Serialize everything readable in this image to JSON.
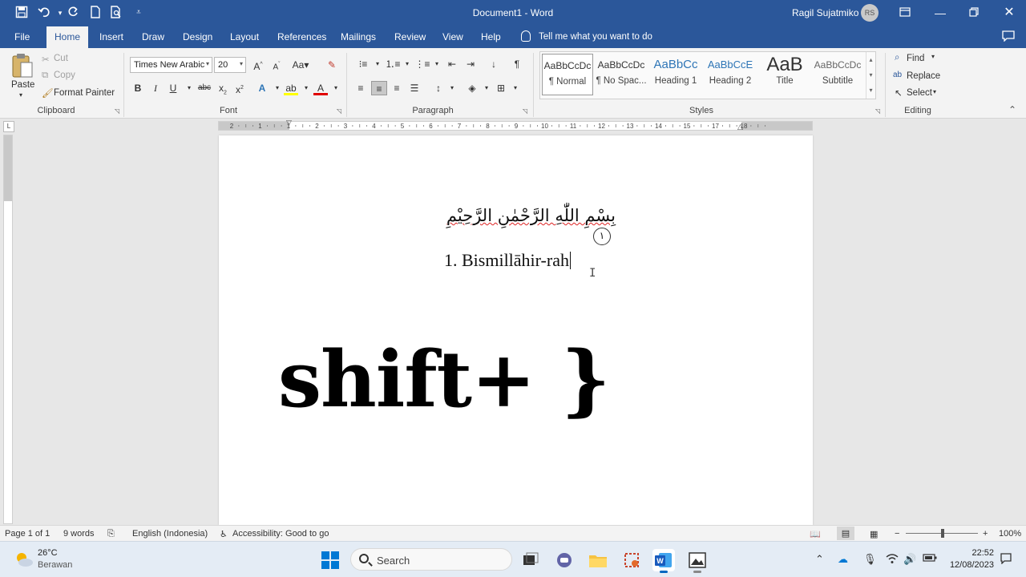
{
  "titlebar": {
    "title": "Document1  -  Word",
    "user": "Ragil Sujatmiko",
    "avatar_initials": "RS",
    "bg_color": "#2b579a"
  },
  "tabs": [
    "File",
    "Home",
    "Insert",
    "Draw",
    "Design",
    "Layout",
    "References",
    "Mailings",
    "Review",
    "View",
    "Help"
  ],
  "active_tab": "Home",
  "tell_me": "Tell me what you want to do",
  "ribbon": {
    "clipboard": {
      "paste": "Paste",
      "cut": "Cut",
      "copy": "Copy",
      "format_painter": "Format Painter",
      "label": "Clipboard"
    },
    "font": {
      "family": "Times New Arabic",
      "size": "20",
      "label": "Font"
    },
    "paragraph": {
      "label": "Paragraph"
    },
    "styles": {
      "label": "Styles",
      "items": [
        {
          "sample": "AaBbCcDc",
          "name": "¶ Normal"
        },
        {
          "sample": "AaBbCcDc",
          "name": "¶ No Spac..."
        },
        {
          "sample": "AaBbCc",
          "name": "Heading 1"
        },
        {
          "sample": "AaBbCcE",
          "name": "Heading 2"
        },
        {
          "sample": "AaB",
          "name": "Title"
        },
        {
          "sample": "AaBbCcDc",
          "name": "Subtitle"
        }
      ]
    },
    "editing": {
      "find": "Find",
      "replace": "Replace",
      "select": "Select",
      "label": "Editing"
    }
  },
  "ruler": {
    "labels": [
      "2",
      "1",
      "1",
      "2",
      "3",
      "4",
      "5",
      "6",
      "7",
      "8",
      "9",
      "10",
      "11",
      "12",
      "13",
      "14",
      "15",
      "17",
      "18"
    ]
  },
  "document": {
    "arabic_text": "بِسْمِ اللّٰهِ الرَّحْمٰنِ الرَّحِيْمِ",
    "ayah_number": "١",
    "transliteration": "1. Bismillāhir-rah",
    "overlay": "shift+ }"
  },
  "statusbar": {
    "page": "Page 1 of 1",
    "words": "9 words",
    "language": "English (Indonesia)",
    "accessibility": "Accessibility: Good to go",
    "zoom": "100%"
  },
  "taskbar": {
    "temperature": "26°C",
    "weather": "Berawan",
    "search": "Search",
    "time": "22:52",
    "date": "12/08/2023"
  }
}
